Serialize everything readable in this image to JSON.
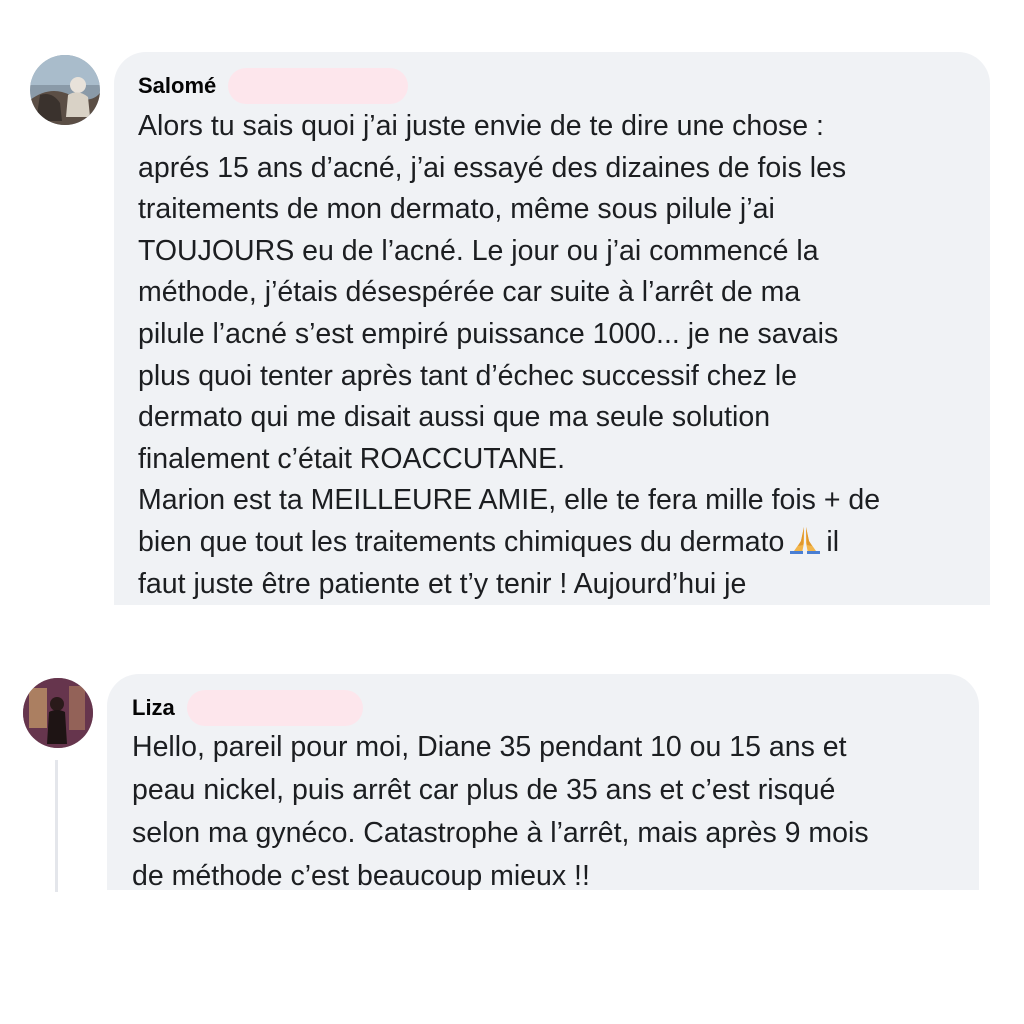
{
  "comments": [
    {
      "author": "Salomé",
      "avatar_icon": "user-photo-avatar",
      "lines": [
        "Alors tu sais quoi j’ai juste envie de te dire une chose :",
        "aprés 15 ans d’acné, j’ai essayé des dizaines de fois les",
        "traitements de mon dermato, même sous pilule j’ai",
        "TOUJOURS eu de l’acné. Le jour ou j’ai commencé la",
        "méthode, j’étais désespérée car suite à l’arrêt de ma",
        "pilule l’acné s’est empiré puissance 1000... je ne savais",
        "plus quoi tenter après tant d’échec successif chez le",
        "dermato qui me disait aussi que ma seule solution",
        "finalement c’était ROACCUTANE.",
        "Marion est ta MEILLEURE AMIE, elle te fera mille fois + de"
      ],
      "line_emoji_before": "bien que tout les traitements chimiques du dermato",
      "line_emoji_icon": "praying-hands-emoji",
      "line_emoji_after": "il",
      "last_line": "faut juste être patiente et t’y tenir ! Aujourd’hui je"
    },
    {
      "author": "Liza",
      "avatar_icon": "user-photo-avatar",
      "lines": [
        "Hello, pareil pour moi, Diane 35 pendant 10 ou 15 ans et",
        "peau nickel, puis arrêt car plus de 35 ans et c’est risqué",
        "selon ma gynéco. Catastrophe à l’arrêt, mais après 9 mois",
        "de méthode c’est beaucoup mieux !!"
      ]
    }
  ],
  "colors": {
    "bubble": "#f0f2f5",
    "redaction": "#fde6ec",
    "text": "#1c1e21",
    "thread_line": "#e4e6eb"
  }
}
